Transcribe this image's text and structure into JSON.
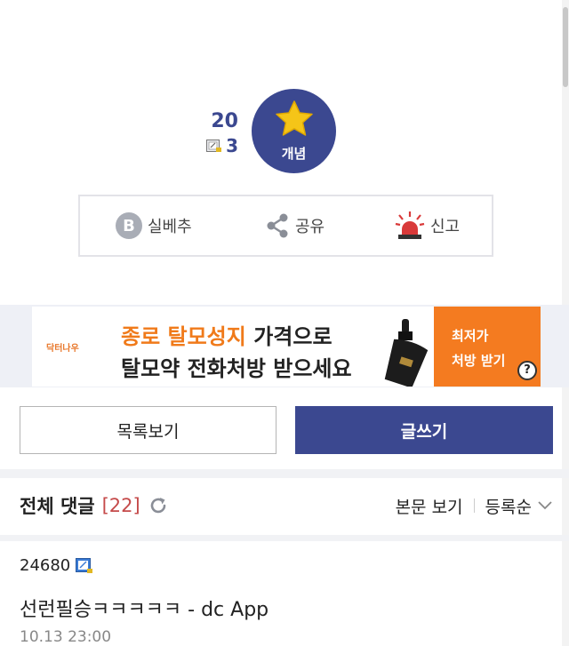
{
  "recommend": {
    "up_count": "20",
    "fix_count": "3",
    "concept_label": "개념"
  },
  "actions": {
    "b_badge": "B",
    "b_label": "실베추",
    "share_label": "공유",
    "report_label": "신고"
  },
  "ad": {
    "logo": "닥터나우",
    "line1_highlight": "종로 탈모성지",
    "line1_rest": " 가격으로",
    "line2": "탈모약 전화처방 받으세요",
    "cta_line1": "최저가",
    "cta_line2": "처방 받기",
    "help": "?"
  },
  "buttons": {
    "list": "목록보기",
    "write": "글쓰기"
  },
  "comments": {
    "title": "전체 댓글",
    "count": "[22]",
    "view_body": "본문 보기",
    "sort": "등록순",
    "first": {
      "author": "24680",
      "text": "선런필승ㅋㅋㅋㅋㅋ - dc App",
      "time": "10.13 23:00"
    }
  },
  "colors": {
    "accent": "#3b4890",
    "count_red": "#c54a4a",
    "ad_orange": "#f47b20",
    "report_red": "#d93a3a"
  }
}
